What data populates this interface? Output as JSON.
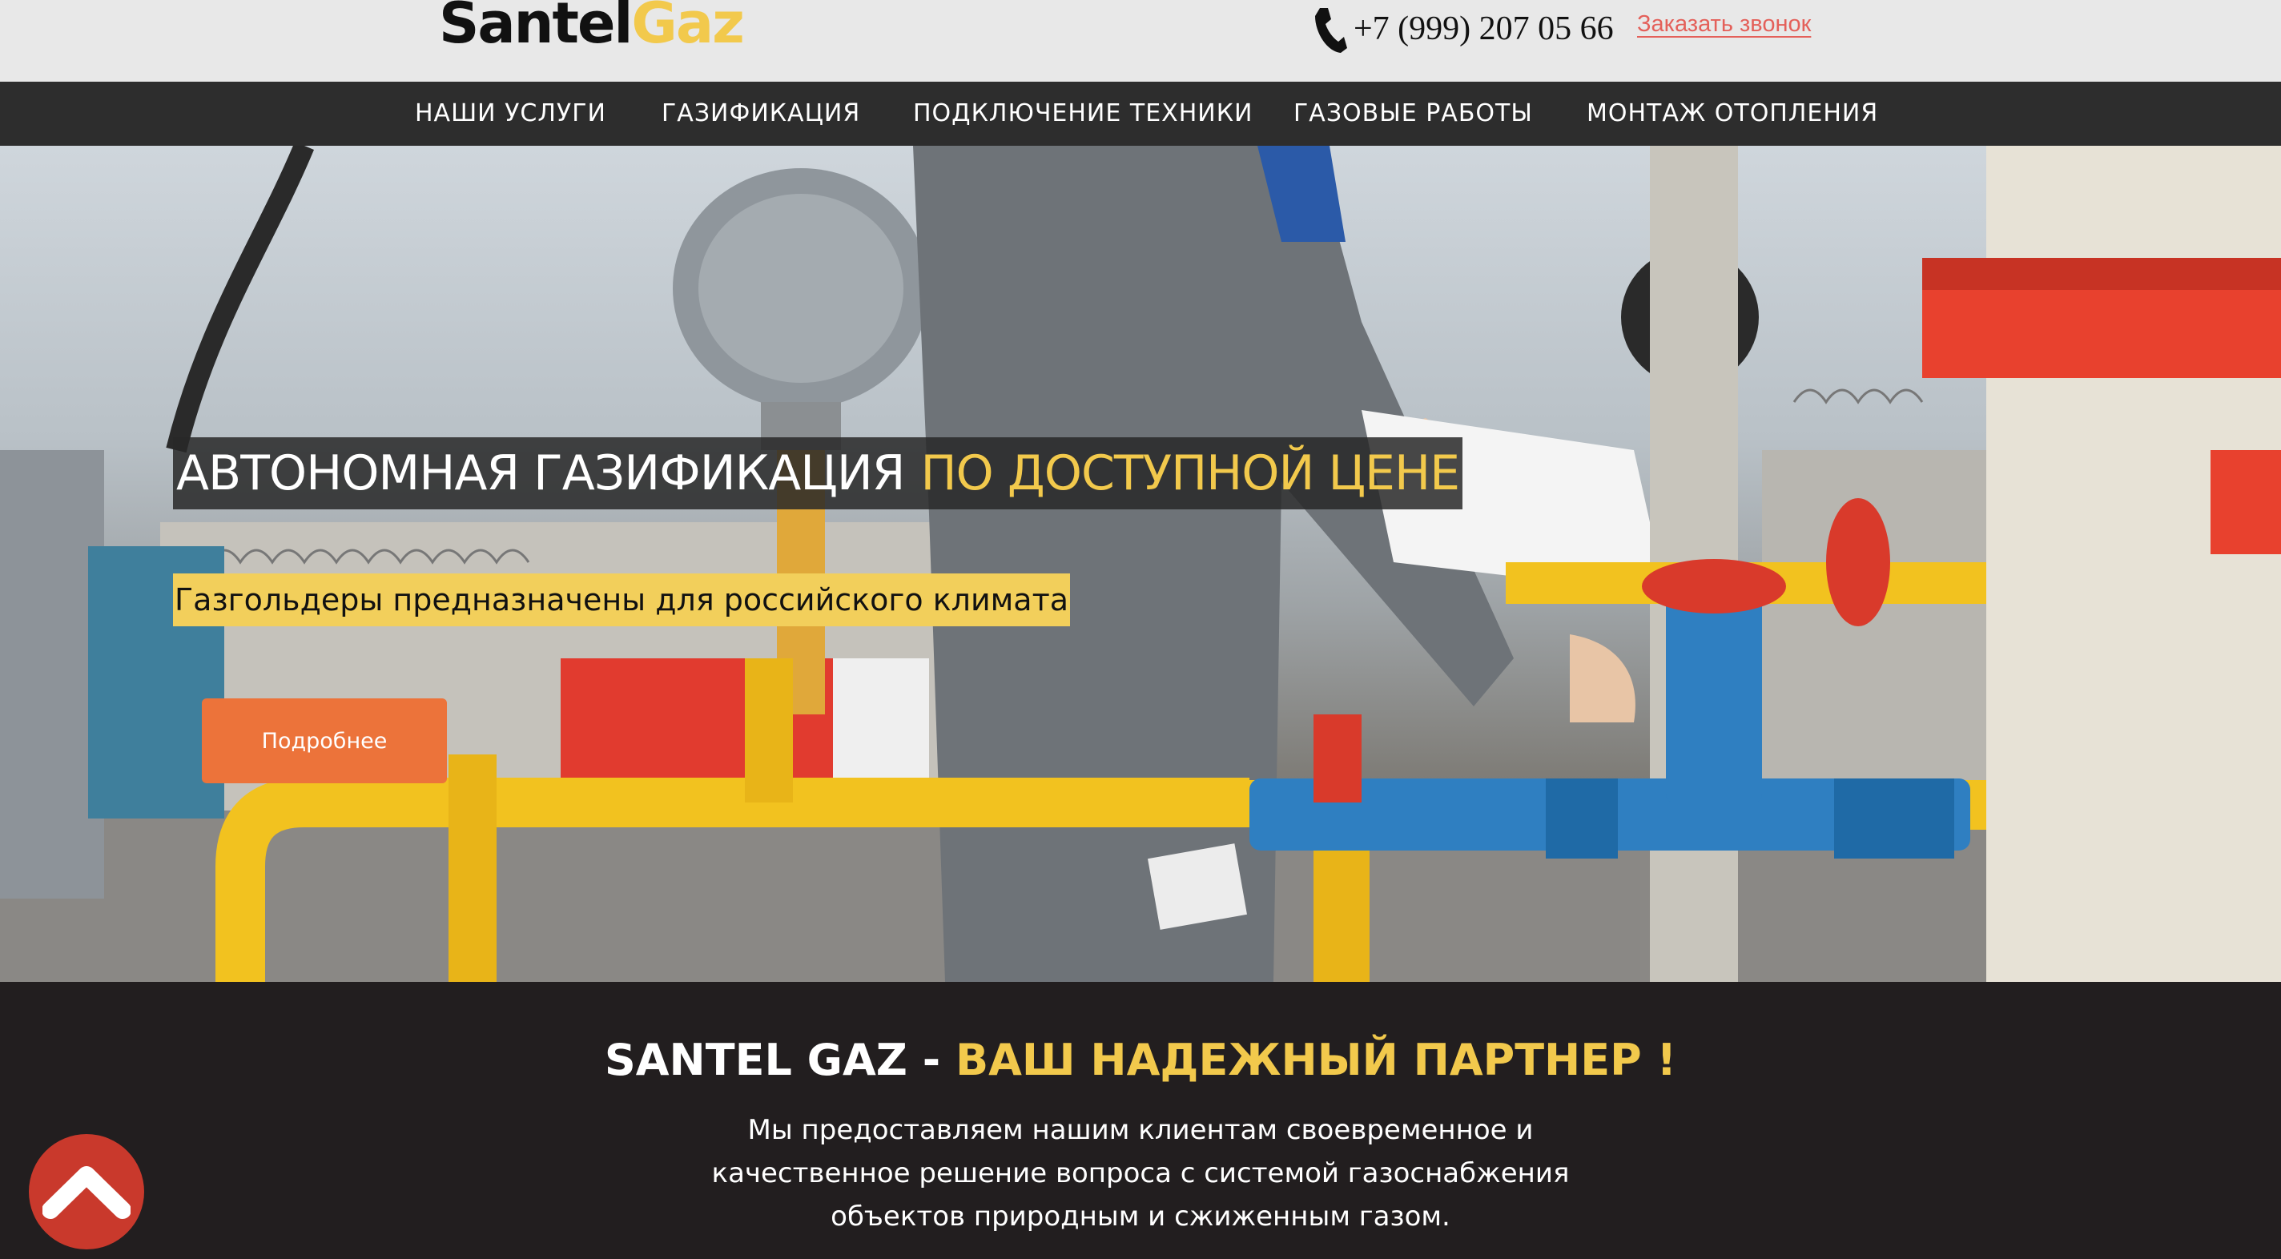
{
  "header": {
    "logo_part1": "Santel",
    "logo_part2": "Gaz",
    "phone": "+7 (999) 207 05 66",
    "callback_label": "Заказать звонок",
    "phone_icon": "phone-icon"
  },
  "nav": {
    "items": [
      {
        "label": "НАШИ УСЛУГИ"
      },
      {
        "label": "ГАЗИФИКАЦИЯ"
      },
      {
        "label": "ПОДКЛЮЧЕНИЕ ТЕХНИКИ"
      },
      {
        "label": "ГАЗОВЫЕ РАБОТЫ"
      },
      {
        "label": "МОНТАЖ ОТОПЛЕНИЯ"
      }
    ]
  },
  "hero": {
    "headline_white": "АВТОНОМНАЯ ГАЗИФИКАЦИЯ",
    "headline_yellow": "ПО ДОСТУПНОЙ ЦЕНЕ",
    "subheadline": "Газгольдеры предназначены для российского климата",
    "button_label": "Подробнее"
  },
  "section": {
    "title_white": "SANTEL GAZ -",
    "title_yellow": "ВАШ НАДЕЖНЫЙ ПАРТНЕР !",
    "text_lines": [
      "Мы предоставляем нашим клиентам своевременное и",
      "качественное решение вопроса с системой газоснабжения",
      "объектов природным и сжиженным газом."
    ]
  },
  "scroll_top_icon": "chevron-up-icon",
  "colors": {
    "accent_yellow": "#f2c94c",
    "button_orange": "#ec733a",
    "callback_red": "#e4605a",
    "nav_bg": "#2d2d2d",
    "section_bg": "#221e1f",
    "scroll_top_red": "#c9392c"
  }
}
